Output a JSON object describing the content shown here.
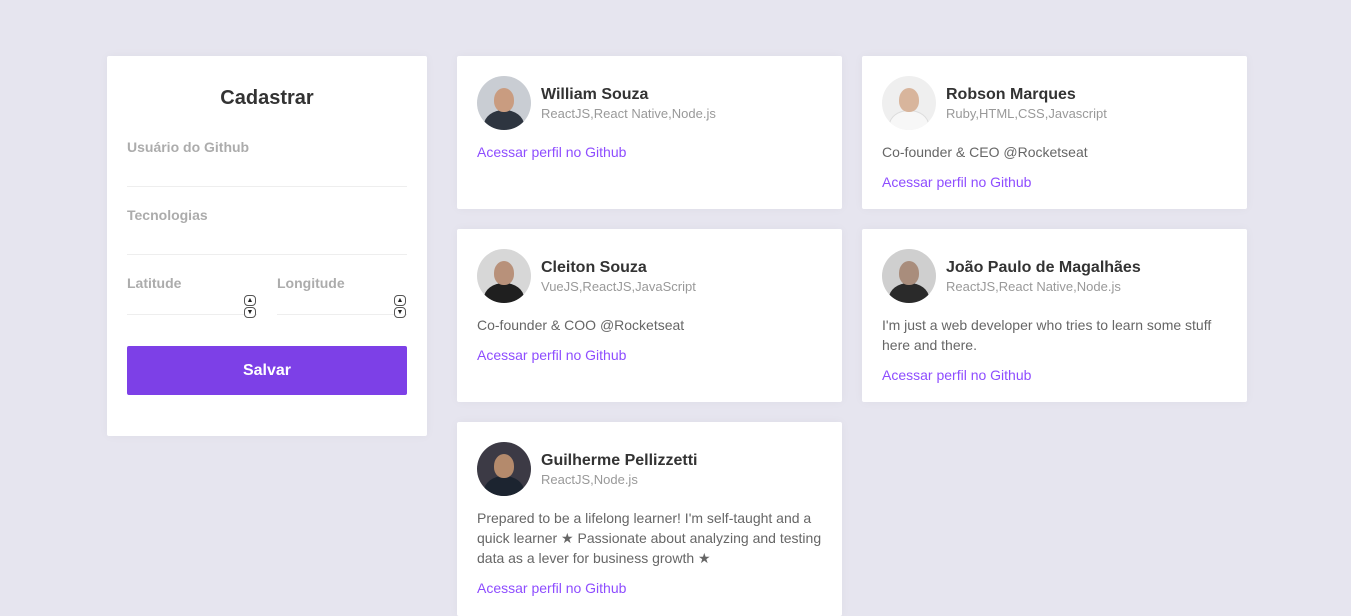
{
  "form": {
    "title": "Cadastrar",
    "github_user_label": "Usuário do Github",
    "github_user_value": "",
    "techs_label": "Tecnologias",
    "techs_value": "",
    "latitude_label": "Latitude",
    "latitude_value": "",
    "longitude_label": "Longitude",
    "longitude_value": "",
    "save_label": "Salvar",
    "accent_color": "#7d40e7"
  },
  "devs": [
    {
      "name": "William Souza",
      "techs": "ReactJS,React Native,Node.js",
      "bio": "",
      "link": "Acessar perfil no Github",
      "avatar_icon": "person-photo"
    },
    {
      "name": "Robson Marques",
      "techs": "Ruby,HTML,CSS,Javascript",
      "bio": "Co-founder & CEO @Rocketseat",
      "link": "Acessar perfil no Github",
      "avatar_icon": "person-photo"
    },
    {
      "name": "Cleiton Souza",
      "techs": "VueJS,ReactJS,JavaScript",
      "bio": "Co-founder & COO @Rocketseat",
      "link": "Acessar perfil no Github",
      "avatar_icon": "person-photo"
    },
    {
      "name": "João Paulo de Magalhães",
      "techs": "ReactJS,React Native,Node.js",
      "bio": "I'm just a web developer who tries to learn some stuff here and there.",
      "link": "Acessar perfil no Github",
      "avatar_icon": "person-photo"
    },
    {
      "name": "Guilherme Pellizzetti",
      "techs": "ReactJS,Node.js",
      "bio": "Prepared to be a lifelong learner! I'm self-taught and a quick learner ★ Passionate about analyzing and testing data as a lever for business growth ★",
      "link": "Acessar perfil no Github",
      "avatar_icon": "person-photo"
    }
  ],
  "colors": {
    "background": "#e6e5ef",
    "link": "#8e4dff"
  }
}
